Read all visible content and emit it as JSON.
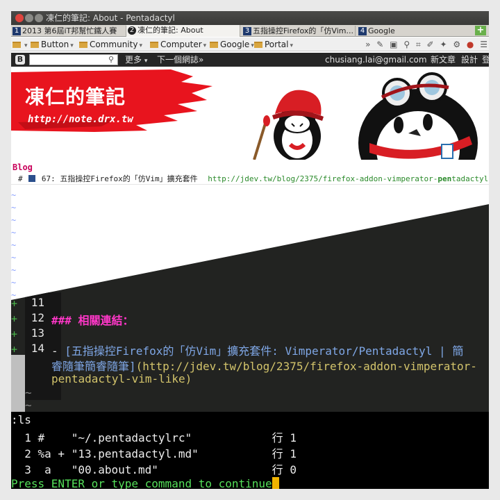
{
  "window": {
    "title": "凍仁的筆記: About - Pentadactyl"
  },
  "tabs": [
    {
      "num": "1",
      "label": "2013 第6屆iT邦幫忙鐵人賽"
    },
    {
      "num": "2",
      "label": "凍仁的筆記: About",
      "active": true
    },
    {
      "num": "3",
      "label": "五指操控Firefox的「仿Vim..."
    },
    {
      "num": "4",
      "label": "Google"
    }
  ],
  "bookmarks": [
    "Button",
    "Community",
    "Computer",
    "Google",
    "Portal"
  ],
  "bookmarks_overflow": "»",
  "navbar": {
    "logo": "B",
    "more": "更多",
    "next_blog": "下一個網誌»",
    "email": "chusiang.lai@gmail.com",
    "new_post": "新文章",
    "design": "設計",
    "login": "登"
  },
  "blog": {
    "title": "凍仁的筆記",
    "url": "http://note.drx.tw",
    "label": "Blog"
  },
  "buffer_line": {
    "prefix": "#",
    "number": "67:",
    "title": "五指操控Firefox的「仿Vim」擴充套件",
    "url_before": "http://jdev.tw/blog/2375/firefox-addon-vimperator-",
    "url_bold": "pen",
    "url_after": "tadactyl-"
  },
  "editor": {
    "lines": [
      {
        "num": "11",
        "text": ""
      },
      {
        "num": "12",
        "text": "### 相關連結："
      },
      {
        "num": "13",
        "text": ""
      },
      {
        "num": "14",
        "text": "- [五指操控Firefox的「仿Vim」擴充套件: Vimperator/Pentadactyl | 簡"
      }
    ],
    "wrap_1_link": "睿隨筆簡睿隨筆]",
    "wrap_1_url": "(http://jdev.tw/blog/2375/firefox-addon-vimperator-",
    "wrap_2_url": "pentadactyl-vim-like)",
    "line14_dash": "- ",
    "line14_link": "[五指操控Firefox的「仿Vim」擴充套件: Vimperator/Pentadactyl | 簡"
  },
  "command": {
    "ls": ":ls",
    "buffers": [
      "  1 #    \"~/.pentadactylrc\"            行 1",
      "  2 %a + \"13.pentadactyl.md\"           行 1",
      "  3  a   \"00.about.md\"                 行 0"
    ],
    "prompt": "Press ENTER or type command to continue"
  },
  "colors": {
    "accent_red": "#e8141e",
    "heading_pink": "#ff37c8",
    "prompt_green": "#55e05a",
    "cursor_orange": "#f0b400"
  }
}
